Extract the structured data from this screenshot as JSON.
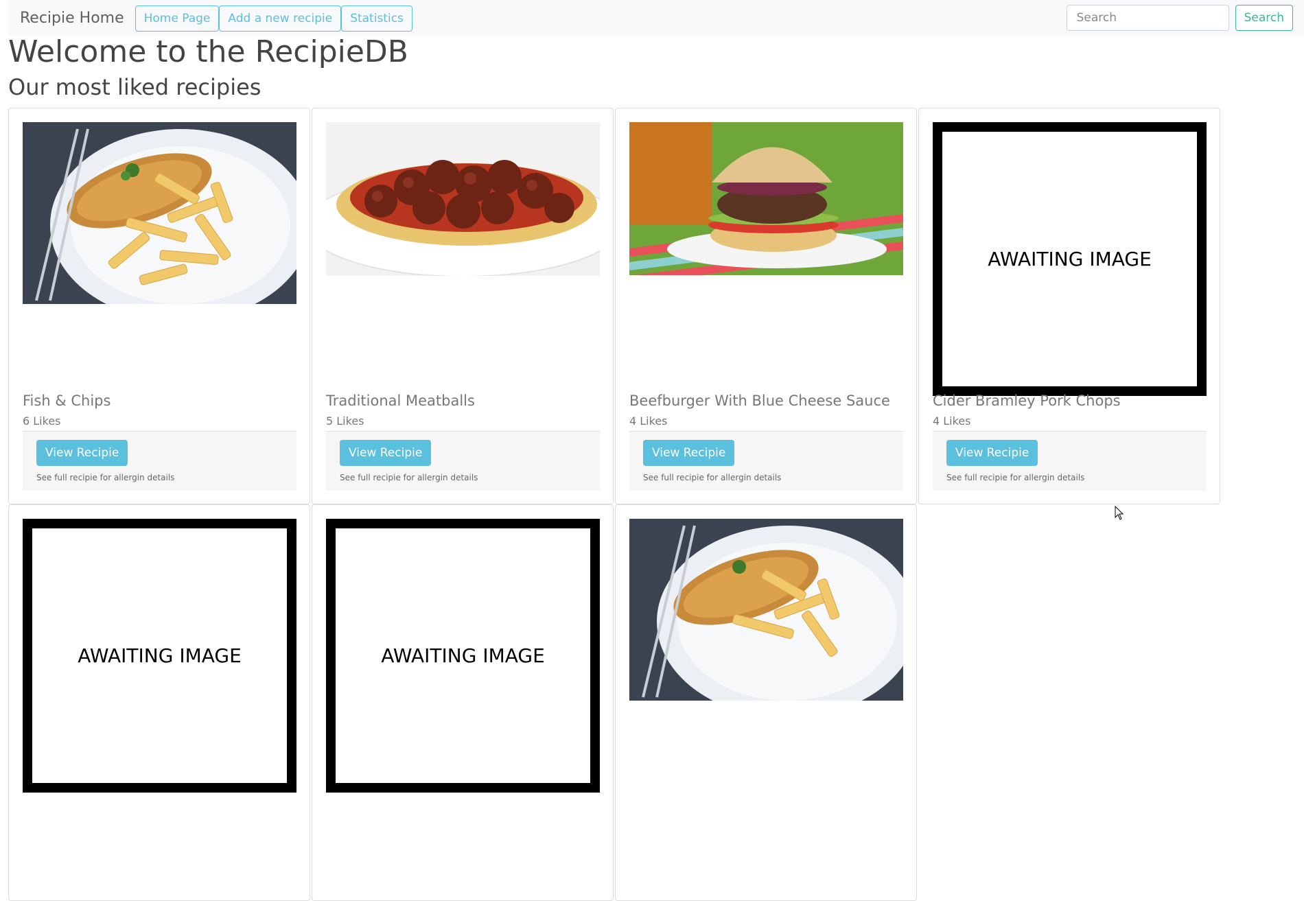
{
  "nav": {
    "brand": "Recipie Home",
    "links": [
      "Home Page",
      "Add a new recipie",
      "Statistics"
    ],
    "search_placeholder": "Search",
    "search_button": "Search"
  },
  "page": {
    "title": "Welcome to the RecipieDB",
    "subtitle": "Our most liked recipies"
  },
  "recipes": [
    {
      "title": "Fish & Chips",
      "likes": "6 Likes",
      "image": "fish-and-chips-photo"
    },
    {
      "title": "Traditional Meatballs",
      "likes": "5 Likes",
      "image": "meatballs-spaghetti-photo"
    },
    {
      "title": "Beefburger With Blue Cheese Sauce",
      "likes": "4 Likes",
      "image": "beefburger-photo"
    },
    {
      "title": "Cider Bramley Pork Chops",
      "likes": "4 Likes",
      "image": "AWAITING IMAGE"
    }
  ],
  "row2_images": [
    "AWAITING IMAGE",
    "AWAITING IMAGE",
    "fish-and-chips-photo"
  ],
  "card_button": "View Recipie",
  "card_note": "See full recipie for allergin details",
  "colors": {
    "info": "#5bc0de",
    "success": "#3fb68e",
    "navbar_bg": "#f8f9fa"
  }
}
